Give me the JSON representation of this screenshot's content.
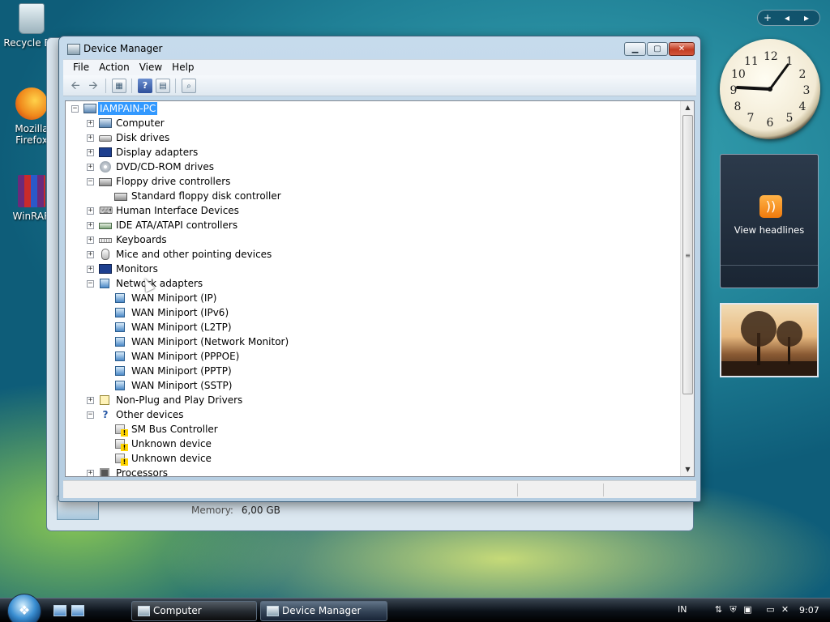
{
  "desktop": {
    "icons": [
      {
        "label": "Recycle Bin",
        "icon": "recycle-bin-icon"
      },
      {
        "label": "Mozilla Firefox",
        "icon": "firefox-icon"
      },
      {
        "label": "WinRAR",
        "icon": "winrar-icon"
      }
    ]
  },
  "bg_window": {
    "memory_label": "Memory:",
    "memory_value": "6,00 GB"
  },
  "window": {
    "title": "Device Manager",
    "controls": {
      "minimize": "▁",
      "maximize": "▢",
      "close": "✕"
    }
  },
  "menu": [
    "File",
    "Action",
    "View",
    "Help"
  ],
  "toolbar": {
    "back": "🡨",
    "forward": "🡪",
    "help": "?"
  },
  "tree": {
    "root": "IAMPAIN-PC",
    "nodes": [
      {
        "label": "Computer",
        "expander": "+"
      },
      {
        "label": "Disk drives",
        "expander": "+"
      },
      {
        "label": "Display adapters",
        "expander": "+"
      },
      {
        "label": "DVD/CD-ROM drives",
        "expander": "+"
      },
      {
        "label": "Floppy drive controllers",
        "expander": "−"
      },
      {
        "label": "Standard floppy disk controller"
      },
      {
        "label": "Human Interface Devices",
        "expander": "+"
      },
      {
        "label": "IDE ATA/ATAPI controllers",
        "expander": "+"
      },
      {
        "label": "Keyboards",
        "expander": "+"
      },
      {
        "label": "Mice and other pointing devices",
        "expander": "+"
      },
      {
        "label": "Monitors",
        "expander": "+"
      },
      {
        "label": "Network adapters",
        "expander": "−"
      },
      {
        "label": "WAN Miniport (IP)"
      },
      {
        "label": "WAN Miniport (IPv6)"
      },
      {
        "label": "WAN Miniport (L2TP)"
      },
      {
        "label": "WAN Miniport (Network Monitor)"
      },
      {
        "label": "WAN Miniport (PPPOE)"
      },
      {
        "label": "WAN Miniport (PPTP)"
      },
      {
        "label": "WAN Miniport (SSTP)"
      },
      {
        "label": "Non-Plug and Play Drivers",
        "expander": "+"
      },
      {
        "label": "Other devices",
        "expander": "−"
      },
      {
        "label": "SM Bus Controller"
      },
      {
        "label": "Unknown device"
      },
      {
        "label": "Unknown device"
      },
      {
        "label": "Processors",
        "expander": "+"
      }
    ]
  },
  "gadgets": {
    "controls": {
      "add": "+",
      "prev": "◂",
      "next": "▸"
    },
    "clock_numbers": [
      "12",
      "1",
      "2",
      "3",
      "4",
      "5",
      "6",
      "7",
      "8",
      "9",
      "10",
      "11"
    ],
    "feed_label": "View headlines"
  },
  "taskbar": {
    "start": "❖",
    "tasks": [
      {
        "label": "Computer"
      },
      {
        "label": "Device Manager"
      }
    ],
    "language": "IN",
    "time": "9:07"
  }
}
